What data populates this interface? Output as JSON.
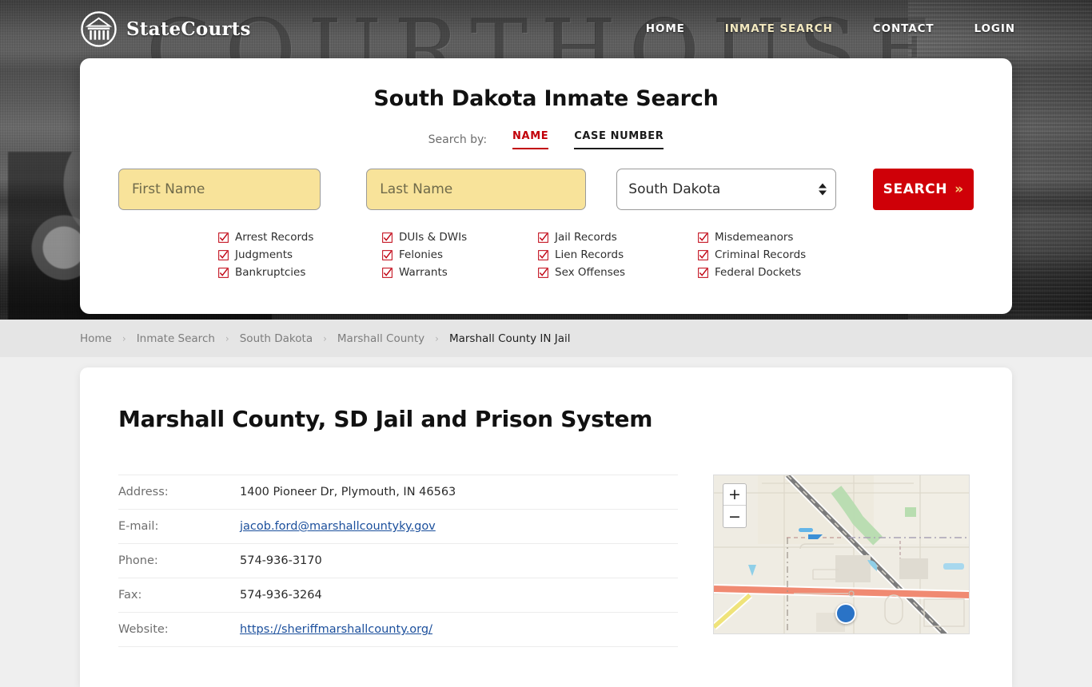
{
  "brand": {
    "name": "StateCourts",
    "logo_icon": "courthouse-logo-icon"
  },
  "nav": {
    "items": [
      {
        "label": "HOME",
        "active": false
      },
      {
        "label": "INMATE SEARCH",
        "active": true
      },
      {
        "label": "CONTACT",
        "active": false
      },
      {
        "label": "LOGIN",
        "active": false
      }
    ]
  },
  "hero": {
    "background_word": "COURTHOUSE"
  },
  "search_card": {
    "title": "South Dakota Inmate Search",
    "search_by_label": "Search by:",
    "tabs": [
      {
        "label": "NAME",
        "active": true
      },
      {
        "label": "CASE NUMBER",
        "active": false
      }
    ],
    "first_name_placeholder": "First Name",
    "first_name_value": "",
    "last_name_placeholder": "Last Name",
    "last_name_value": "",
    "state_selected": "South Dakota",
    "state_options": [
      "South Dakota"
    ],
    "search_button": "SEARCH",
    "search_button_chevron": "»",
    "record_types": [
      "Arrest Records",
      "DUIs & DWIs",
      "Jail Records",
      "Misdemeanors",
      "Judgments",
      "Felonies",
      "Lien Records",
      "Criminal Records",
      "Bankruptcies",
      "Warrants",
      "Sex Offenses",
      "Federal Dockets"
    ],
    "accent_color": "#cf0008",
    "field_color": "#f8e39a"
  },
  "breadcrumb": {
    "separator": "›",
    "items": [
      {
        "label": "Home",
        "current": false
      },
      {
        "label": "Inmate Search",
        "current": false
      },
      {
        "label": "South Dakota",
        "current": false
      },
      {
        "label": "Marshall County",
        "current": false
      },
      {
        "label": "Marshall County IN Jail",
        "current": true
      }
    ]
  },
  "main": {
    "heading": "Marshall County, SD Jail and Prison System",
    "info_rows": [
      {
        "label": "Address:",
        "value": "1400 Pioneer Dr, Plymouth, IN 46563",
        "link": false
      },
      {
        "label": "E-mail:",
        "value": "jacob.ford@marshallcountyky.gov",
        "link": true
      },
      {
        "label": "Phone:",
        "value": "574-936-3170",
        "link": false
      },
      {
        "label": "Fax:",
        "value": "574-936-3264",
        "link": false
      },
      {
        "label": "Website:",
        "value": "https://sheriffmarshallcounty.org/",
        "link": true
      }
    ]
  },
  "map": {
    "zoom_in_label": "+",
    "zoom_out_label": "−",
    "marker_name": "location-marker"
  }
}
